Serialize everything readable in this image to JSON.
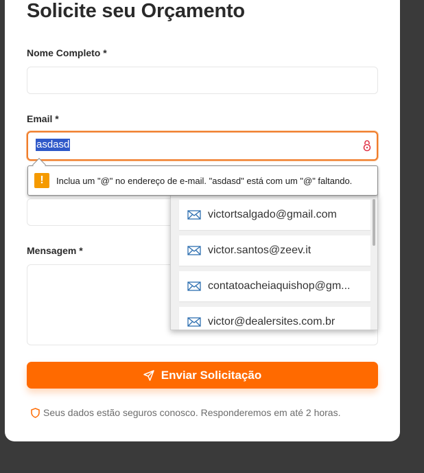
{
  "form": {
    "title": "Solicite seu Orçamento",
    "name_label": "Nome Completo *",
    "email_label": "Email *",
    "email_value": "asdasd",
    "message_label": "Mensagem *",
    "submit_label": "Enviar Solicitação",
    "privacy_note": "Seus dados estão seguros conosco. Responderemos em até 2 horas."
  },
  "validation": {
    "message": "Inclua um \"@\" no endereço de e-mail. \"asdasd\" está com um \"@\" faltando."
  },
  "autocomplete": {
    "items": [
      "victortsalgado@gmail.com",
      "victor.santos@zeev.it",
      "contatoacheiaquishop@gm...",
      "victor@dealersites.com.br"
    ]
  },
  "colors": {
    "accent": "#ff6a00",
    "focus_border": "#f07d2a",
    "warning": "#f59a00"
  }
}
